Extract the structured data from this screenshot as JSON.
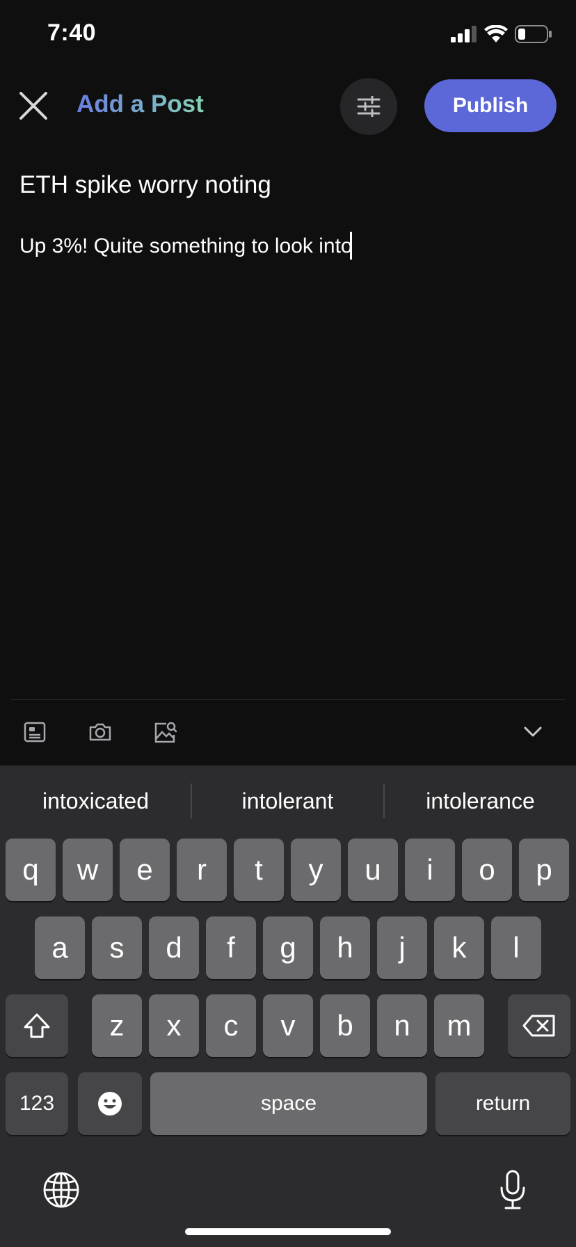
{
  "status": {
    "time": "7:40"
  },
  "header": {
    "title": "Add a Post",
    "publish_label": "Publish"
  },
  "editor": {
    "title_text": "ETH spike worry noting",
    "body_text": "Up 3%! Quite something to look into"
  },
  "toolbar": {
    "icons": [
      "post-template-icon",
      "camera-icon",
      "image-search-icon",
      "chevron-down-icon"
    ]
  },
  "keyboard": {
    "suggestions": [
      "intoxicated",
      "intolerant",
      "intolerance"
    ],
    "row1": [
      "q",
      "w",
      "e",
      "r",
      "t",
      "y",
      "u",
      "i",
      "o",
      "p"
    ],
    "row2": [
      "a",
      "s",
      "d",
      "f",
      "g",
      "h",
      "j",
      "k",
      "l"
    ],
    "row3": [
      "z",
      "x",
      "c",
      "v",
      "b",
      "n",
      "m"
    ],
    "numbers_label": "123",
    "space_label": "space",
    "return_label": "return"
  },
  "colors": {
    "accent": "#5c67d8",
    "title_gradient_start": "#6a7fe0",
    "title_gradient_end": "#86d3b6",
    "background": "#0f0f10"
  }
}
